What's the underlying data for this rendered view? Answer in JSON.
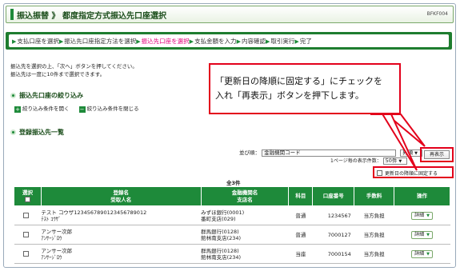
{
  "header": {
    "title": "振込振替 》 都度指定方式振込先口座選択",
    "screen_id": "BFKF004"
  },
  "steps": [
    {
      "label": "支払口座を選択",
      "active": false
    },
    {
      "label": "振込先口座指定方法を選択",
      "active": false
    },
    {
      "label": "振込先口座を選択",
      "active": true
    },
    {
      "label": "支払金額を入力",
      "active": false
    },
    {
      "label": "内容確認",
      "active": false
    },
    {
      "label": "取引実行",
      "active": false
    },
    {
      "label": "完了",
      "active": false
    }
  ],
  "intro": {
    "line1": "振込先を選択の上、「次へ」ボタンを押してください。",
    "line2": "振込先は一度に10件まで選択できます。"
  },
  "filter": {
    "heading": "振込先口座の絞り込み",
    "open_label": "絞り込み条件を開く",
    "close_label": "絞り込み条件を閉じる"
  },
  "list": {
    "heading": "登録振込先一覧",
    "sort_label": "並び順：",
    "sort_value": "金融機関コード",
    "order_value": "昇順",
    "redisplay_label": "再表示",
    "perpage_label": "1ページ毎の表示件数：",
    "perpage_value": "50件",
    "fix_label": "更新日の降順に固定する",
    "count": "全3件"
  },
  "callout": {
    "line1": "「更新日の降順に固定する」にチェックを",
    "line2": "入れ「再表示」ボタンを押下します。"
  },
  "table": {
    "headers": {
      "select": "選択",
      "name1": "登録名",
      "name2": "受取人名",
      "bank1": "金融機関名",
      "bank2": "支店名",
      "type": "科目",
      "account": "口座番号",
      "fee": "手数料",
      "action": "操作"
    },
    "rows": [
      {
        "name": "テスト コウザ1234567890123456789012",
        "kana": "ﾃｽﾄ ｺｳｻﾞ",
        "bank": "みずほ銀行(0001)",
        "branch": "番町支店(029)",
        "type": "普通",
        "account": "1234567",
        "fee": "当方負担",
        "detail": "詳細"
      },
      {
        "name": "アンサー次郎",
        "kana": "ｱﾝｻｰｼﾞﾛｳ",
        "bank": "群馬銀行(0128)",
        "branch": "館林南支店(234)",
        "type": "普通",
        "account": "7000127",
        "fee": "当方負担",
        "detail": "詳細"
      },
      {
        "name": "アンサー次郎",
        "kana": "ｱﾝｻｰｼﾞﾛｳ",
        "bank": "群馬銀行(0128)",
        "branch": "館林南支店(234)",
        "type": "当座",
        "account": "7000154",
        "fee": "当方負担",
        "detail": "詳細"
      }
    ]
  }
}
